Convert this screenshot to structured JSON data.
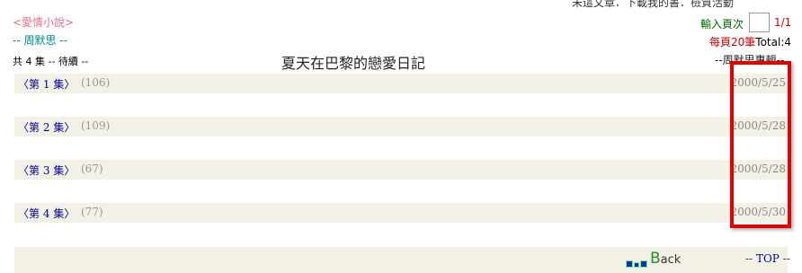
{
  "header": {
    "top_cut_text": "未這文章．下載我的書．檢質活動",
    "category": "<愛情小說>",
    "author": "-- 周默思 --",
    "page_label": "輸入頁次",
    "page_input_value": "",
    "page_count": "1/1",
    "per_page_prefix": "每頁",
    "per_page_num": "20筆",
    "per_page_total": "Total:4",
    "episodes_info": "共 4 集 -- 待續 --",
    "book_title": "夏天在巴黎的戀愛日記",
    "collection": "--周默思專輯--"
  },
  "episodes": [
    {
      "label_open": "〈第",
      "num": "1",
      "label_close": "集〉",
      "count": "(106)",
      "date": "2000/5/25"
    },
    {
      "label_open": "〈第",
      "num": "2",
      "label_close": "集〉",
      "count": "(109)",
      "date": "2000/5/28"
    },
    {
      "label_open": "〈第",
      "num": "3",
      "label_close": "集〉",
      "count": "(67)",
      "date": "2000/5/28"
    },
    {
      "label_open": "〈第",
      "num": "4",
      "label_close": "集〉",
      "count": "(77)",
      "date": "2000/5/30"
    }
  ],
  "footer": {
    "back_cap": "B",
    "back_rest": "ack",
    "top_prefix": "-- ",
    "top_word": "TOP",
    "top_suffix": " --"
  },
  "colors": {
    "highlight": "#e00000",
    "row_bg": "#f3f1e6",
    "link": "#000099"
  },
  "icons": [
    "back-icon"
  ]
}
